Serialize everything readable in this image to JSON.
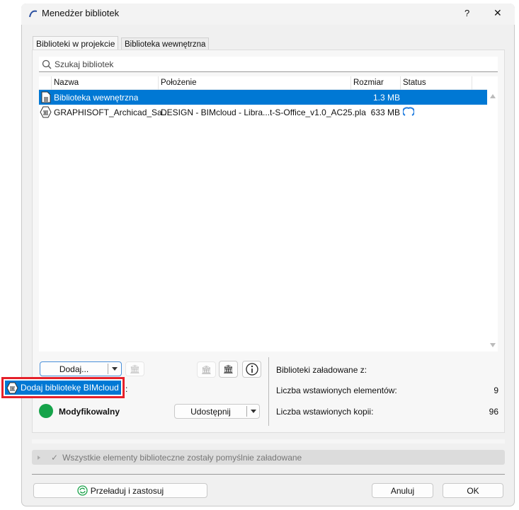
{
  "window": {
    "title": "Menedżer bibliotek",
    "help": "?",
    "close": "✕"
  },
  "tabs": [
    {
      "label": "Biblioteki w projekcie"
    },
    {
      "label": "Biblioteka wewnętrzna"
    }
  ],
  "search": {
    "placeholder": "Szukaj bibliotek"
  },
  "table": {
    "columns": [
      "Nazwa",
      "Położenie",
      "Rozmiar",
      "Status"
    ],
    "rows": [
      {
        "name": "Biblioteka wewnętrzna",
        "location": "",
        "size": "1.3 MB",
        "status_icon": "none",
        "selected": true
      },
      {
        "name": "GRAPHISOFT_Archicad_Sa...",
        "location": "DESIGN - BIMcloud - Libra...t-S-Office_v1.0_AC25.pla",
        "size": "633 MB",
        "status_icon": "cloud-sync-icon",
        "selected": false
      }
    ]
  },
  "actions": {
    "add_label": "Dodaj...",
    "menu_item": "Dodaj bibliotekę BIMcloud",
    "menu_suffix": ":",
    "status_label": "Modyfikowalny",
    "share_label": "Udostępnij"
  },
  "info": {
    "loaded_from_label": "Biblioteki załadowane z:",
    "elements_label": "Liczba wstawionych elementów:",
    "elements_value": "9",
    "copies_label": "Liczba wstawionych kopii:",
    "copies_value": "96"
  },
  "statusbar": {
    "message": "Wszystkie elementy biblioteczne zostały pomyślnie załadowane"
  },
  "footer": {
    "reload_label": "Przeładuj i zastosuj",
    "cancel_label": "Anuluj",
    "ok_label": "OK"
  },
  "colors": {
    "selection": "#0078d4",
    "status_green": "#16a34a",
    "highlight_border": "#e5202a"
  }
}
